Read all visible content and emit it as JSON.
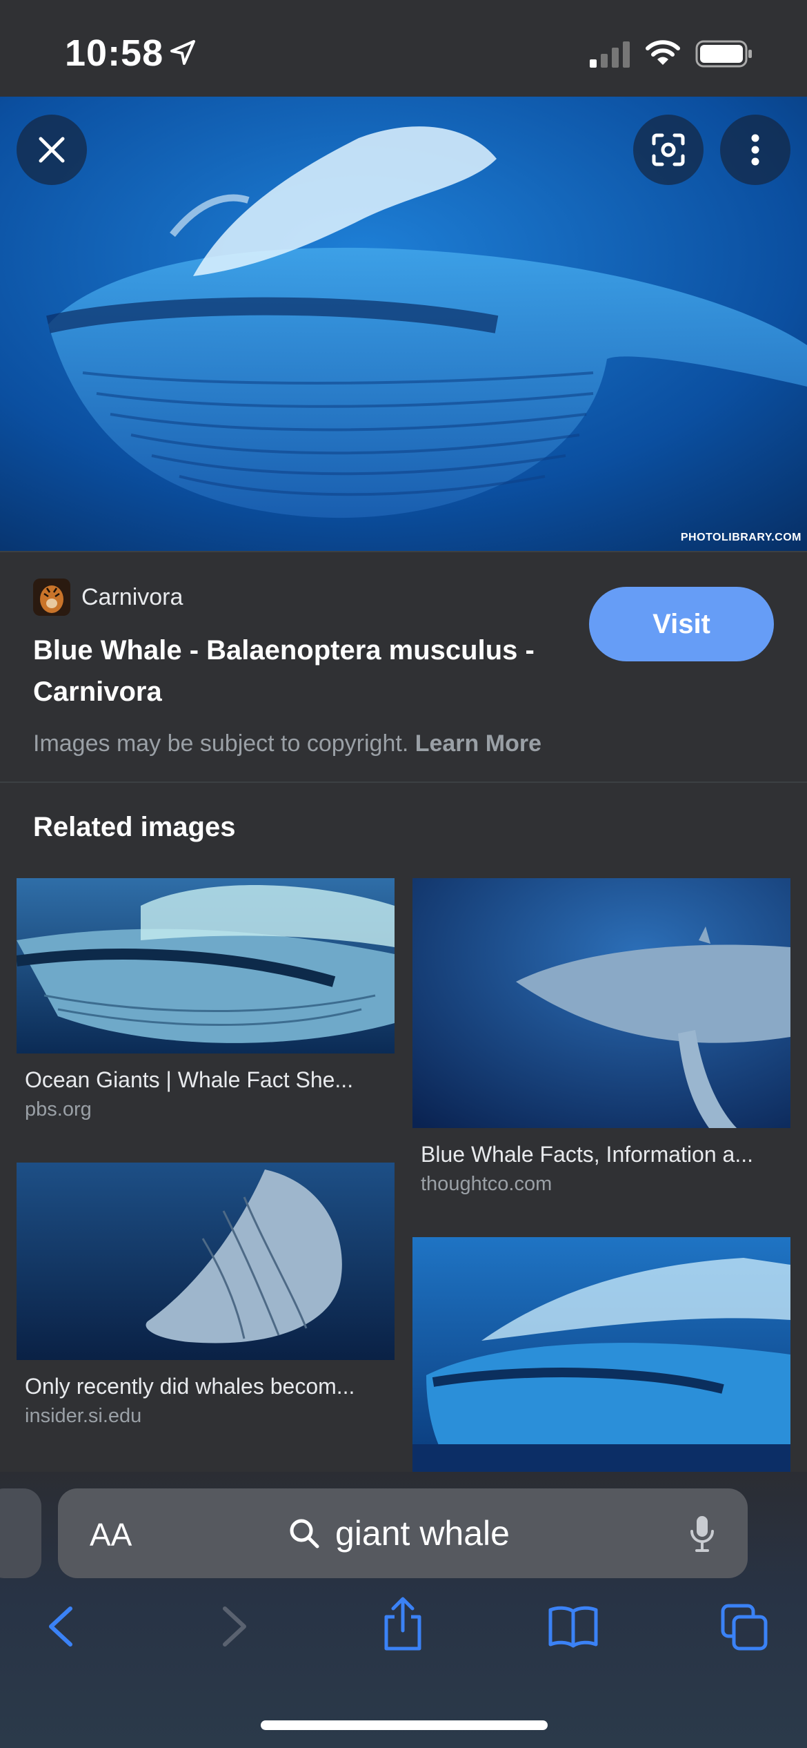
{
  "status_bar": {
    "time": "10:58",
    "icons": [
      "location-arrow-icon",
      "cellular-signal-icon",
      "wifi-icon",
      "battery-icon"
    ]
  },
  "hero": {
    "watermark": "PHOTOLIBRARY.COM",
    "buttons": [
      "close-icon",
      "google-lens-icon",
      "more-vert-icon"
    ]
  },
  "result": {
    "source_name": "Carnivora",
    "title": "Blue Whale - Balaenoptera musculus - Carnivora",
    "visit_label": "Visit",
    "copyright_text": "Images may be subject to copyright.",
    "learn_more_label": "Learn More"
  },
  "related": {
    "heading": "Related images",
    "items": [
      {
        "caption": "Ocean Giants | Whale Fact She...",
        "site": "pbs.org"
      },
      {
        "caption": "Blue Whale Facts, Information a...",
        "site": "thoughtco.com"
      },
      {
        "caption": "Only recently did whales becom...",
        "site": "insider.si.edu"
      },
      {
        "caption": "",
        "site": ""
      }
    ]
  },
  "address_bar": {
    "text_size_label": "AA",
    "query": "giant whale"
  },
  "toolbar": {
    "icons": [
      "back-icon",
      "forward-icon",
      "share-icon",
      "bookmarks-icon",
      "tabs-icon"
    ]
  },
  "colors": {
    "background": "#303134",
    "visit_button": "#669df6",
    "toolbar_accent": "#3b82f6"
  }
}
